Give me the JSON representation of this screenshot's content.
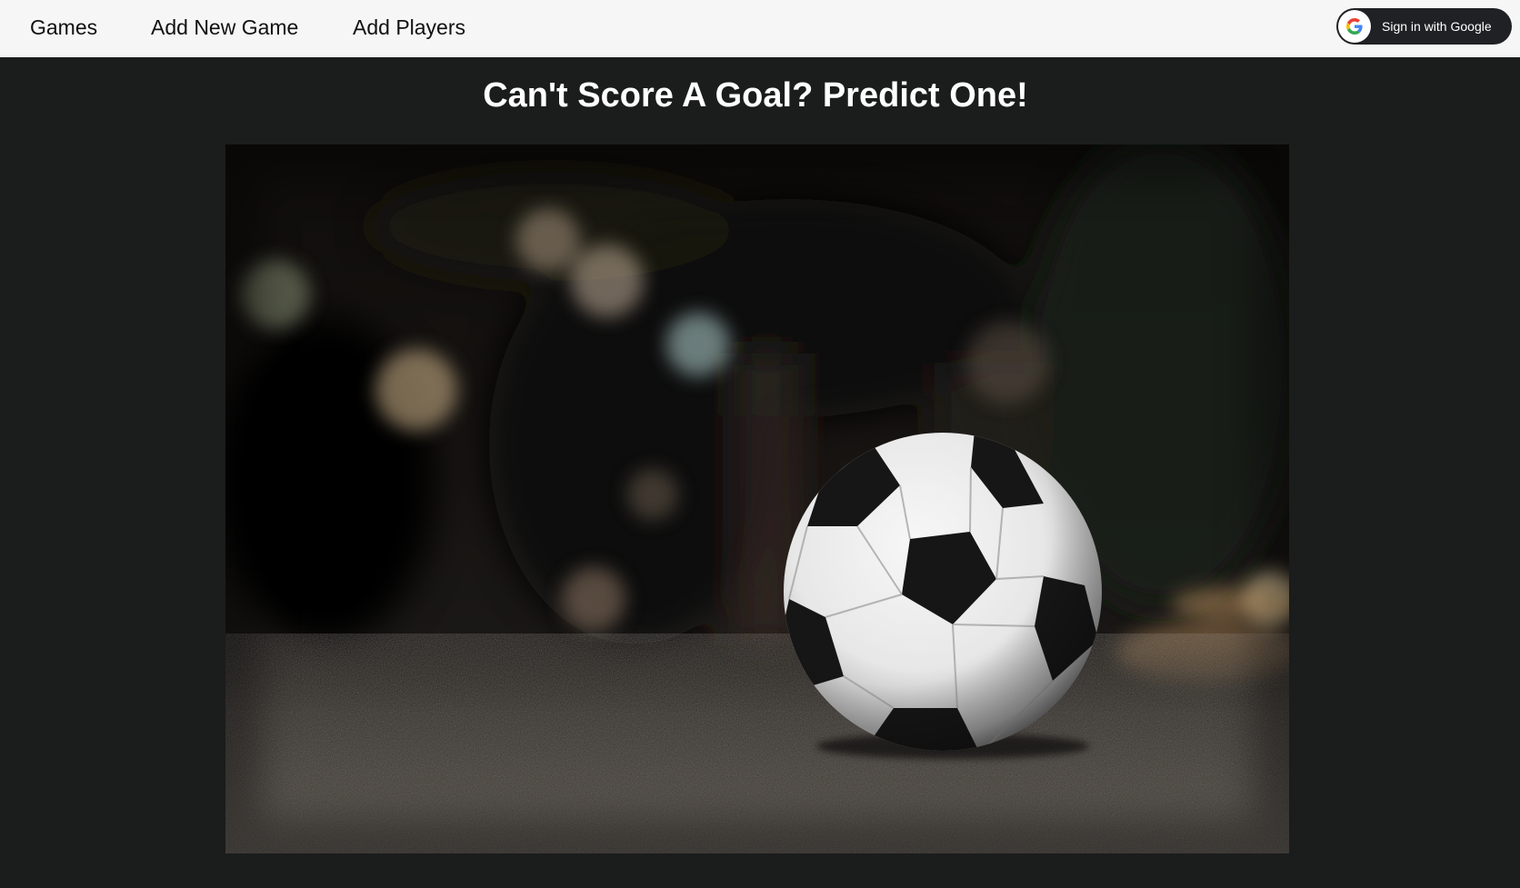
{
  "nav": {
    "links": [
      {
        "label": "Games"
      },
      {
        "label": "Add New Game"
      },
      {
        "label": "Add Players"
      }
    ],
    "signin": {
      "label": "Sign in with Google",
      "icon": "google-g-icon"
    }
  },
  "main": {
    "headline": "Can't Score A Goal? Predict One!",
    "hero_image": {
      "subject": "soccer-ball-photo"
    }
  },
  "colors": {
    "navbar_bg": "#f6f6f6",
    "page_bg": "#1b1c1c",
    "signin_bg": "#202124",
    "headline": "#ffffff"
  }
}
